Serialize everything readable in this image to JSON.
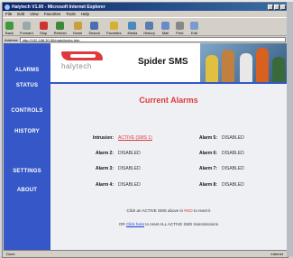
{
  "window": {
    "title": "Halytech V1.00 - Microsoft Internet Explorer"
  },
  "menu": [
    "File",
    "Edit",
    "View",
    "Favorites",
    "Tools",
    "Help"
  ],
  "toolbar": [
    {
      "label": "Back",
      "icon": "back-icon"
    },
    {
      "label": "Forward",
      "icon": "forward-icon"
    },
    {
      "label": "Stop",
      "icon": "stop-icon"
    },
    {
      "label": "Refresh",
      "icon": "refresh-icon"
    },
    {
      "label": "Home",
      "icon": "home-icon"
    },
    {
      "label": "Search",
      "icon": "search-icon"
    },
    {
      "label": "Favorites",
      "icon": "favorites-icon"
    },
    {
      "label": "Media",
      "icon": "media-icon"
    },
    {
      "label": "History",
      "icon": "history-icon"
    },
    {
      "label": "Mail",
      "icon": "mail-icon"
    },
    {
      "label": "Print",
      "icon": "print-icon"
    },
    {
      "label": "Edit",
      "icon": "edit-icon"
    }
  ],
  "address": {
    "label": "Address",
    "url": "http://192.168.30.50/main/index.htm"
  },
  "sidebar": {
    "items": [
      {
        "label": "ALARMS"
      },
      {
        "label": "STATUS"
      },
      {
        "label": "CONTROLS"
      },
      {
        "label": "HISTORY"
      },
      {
        "label": "SETTINGS"
      },
      {
        "label": "ABOUT"
      }
    ]
  },
  "header": {
    "logo_text": "halytech",
    "app_title": "Spider SMS"
  },
  "alarms": {
    "title": "Current Alarms",
    "rows": [
      {
        "left_label": "Intrusion:",
        "left_value": "ACTIVE (SMS 1)",
        "right_label": "Alarm 5:",
        "right_value": "DISABLED"
      },
      {
        "left_label": "Alarm 2:",
        "left_value": "DISABLED",
        "right_label": "Alarm 6:",
        "right_value": "DISABLED"
      },
      {
        "left_label": "Alarm 3:",
        "left_value": "DISABLED",
        "right_label": "Alarm 7:",
        "right_value": "DISABLED"
      },
      {
        "left_label": "Alarm 4:",
        "left_value": "DISABLED",
        "right_label": "Alarm 8:",
        "right_value": "DISABLED"
      }
    ],
    "note1_a": "Click an ACTIVE SMS above in ",
    "note1_red": "RED",
    "note1_b": " to reset it",
    "note2_a": "OR ",
    "note2_link": "Click here",
    "note2_b": " to reset ALL ACTIVE SMS transmissions"
  },
  "statusbar": {
    "text": "Done",
    "zone": "Internet"
  },
  "colors": {
    "sidebar": "#3557c7",
    "accent_red": "#e0393b",
    "panel": "#eef0f4"
  }
}
